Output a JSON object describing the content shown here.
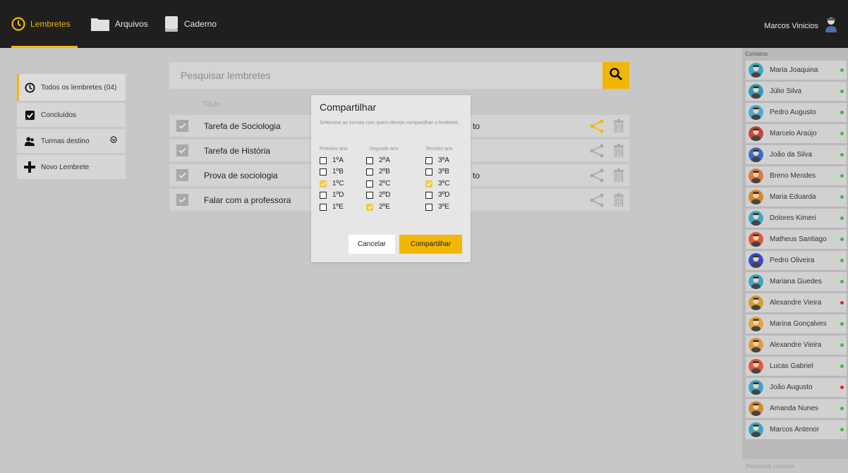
{
  "topbar": {
    "tabs": [
      {
        "label": "Lembretes",
        "icon": "clock-icon"
      },
      {
        "label": "Arquivos",
        "icon": "folder-icon"
      },
      {
        "label": "Caderno",
        "icon": "notebook-icon"
      }
    ],
    "user": {
      "name": "Marcos Vinicios",
      "icon": "avatar-icon"
    },
    "accent": "#f2b705"
  },
  "sidebar": {
    "items": [
      {
        "label": "Todos os lembretes (04)",
        "icon": "clock-icon"
      },
      {
        "label": "Concluídos",
        "icon": "checkbox-icon"
      },
      {
        "label": "Turmas destino",
        "icon": "users-icon"
      },
      {
        "label": "Novo Lembrete",
        "icon": "plus-icon"
      }
    ]
  },
  "search": {
    "placeholder": "Pesquisar lembretes"
  },
  "list": {
    "column_title": "Título",
    "rows": [
      {
        "title": "Tarefa de Sociologia",
        "extra": "to",
        "shared": true
      },
      {
        "title": "Tarefa de História",
        "extra": "",
        "shared": false
      },
      {
        "title": "Prova de sociologia",
        "extra": "to",
        "shared": false
      },
      {
        "title": "Falar com a professora",
        "extra": "",
        "shared": false
      }
    ]
  },
  "contacts": {
    "header": "Contatos",
    "search_placeholder": "Pesquisar contatos",
    "items": [
      {
        "name": "Maria Joaquina",
        "status": "online"
      },
      {
        "name": "Júlio Silva",
        "status": "online"
      },
      {
        "name": "Pedro Augusto",
        "status": "online"
      },
      {
        "name": "Marcelo Araújo",
        "status": "online"
      },
      {
        "name": "João da Silva",
        "status": "online"
      },
      {
        "name": "Breno Mendes",
        "status": "online"
      },
      {
        "name": "Maria Eduarda",
        "status": "online"
      },
      {
        "name": "Dolores Kimeri",
        "status": "online"
      },
      {
        "name": "Matheus Santiago",
        "status": "online"
      },
      {
        "name": "Pedro Oliveira",
        "status": "online"
      },
      {
        "name": "Mariana Guedes",
        "status": "online"
      },
      {
        "name": "Alexandre Vieira",
        "status": "offline"
      },
      {
        "name": "Marina Gonçalves",
        "status": "online"
      },
      {
        "name": "Alexandre Vieira",
        "status": "online"
      },
      {
        "name": "Lucas Gabriel",
        "status": "online"
      },
      {
        "name": "João Augusto",
        "status": "offline"
      },
      {
        "name": "Amanda Nunes",
        "status": "online"
      },
      {
        "name": "Marcos Antenor",
        "status": "online"
      }
    ],
    "status_colors": {
      "online": "#35c035",
      "offline": "#e02424"
    }
  },
  "modal": {
    "title": "Compartilhar",
    "description": "Selecione as turmas com quem deseja compartilhar o lembrete.",
    "columns": [
      {
        "header": "Primeiro ano",
        "options": [
          {
            "label": "1ºA",
            "checked": false
          },
          {
            "label": "1ºB",
            "checked": false
          },
          {
            "label": "1ºC",
            "checked": true
          },
          {
            "label": "1ºD",
            "checked": false
          },
          {
            "label": "1ºE",
            "checked": false
          }
        ]
      },
      {
        "header": "Segundo ano",
        "options": [
          {
            "label": "2ºA",
            "checked": false
          },
          {
            "label": "2ºB",
            "checked": false
          },
          {
            "label": "2ºC",
            "checked": false
          },
          {
            "label": "2ºD",
            "checked": false
          },
          {
            "label": "2ºE",
            "checked": true
          }
        ]
      },
      {
        "header": "Terceiro ano",
        "options": [
          {
            "label": "3ºA",
            "checked": false
          },
          {
            "label": "3ºB",
            "checked": false
          },
          {
            "label": "3ºC",
            "checked": true
          },
          {
            "label": "3ºD",
            "checked": false
          },
          {
            "label": "3ºE",
            "checked": false
          }
        ]
      }
    ],
    "cancel_label": "Cancelar",
    "share_label": "Compartilhar"
  }
}
